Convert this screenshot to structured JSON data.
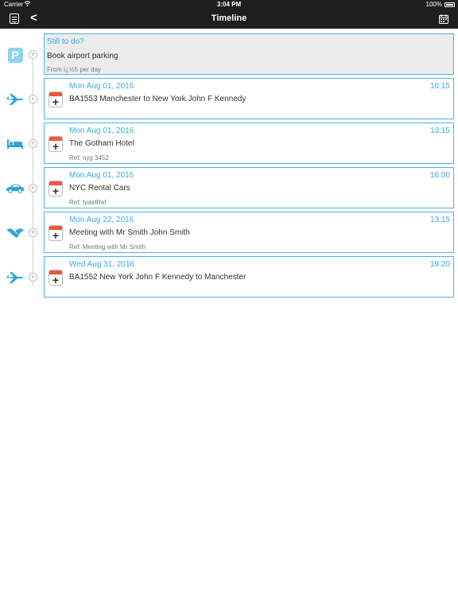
{
  "status_bar": {
    "carrier": "Carrier",
    "wifi_icon": "wifi-icon",
    "time": "3:04 PM",
    "battery": "100%"
  },
  "nav": {
    "title": "Timeline",
    "back_label": "<",
    "menu_icon": "menu-icon",
    "calendar_icon": "calendar-icon"
  },
  "colors": {
    "accent": "#3aa9dd",
    "border": "#4fb4e3",
    "bar": "#1e1e1e",
    "calendar_red": "#f0583d",
    "icon_blue": "#2ea4dc"
  },
  "todo": {
    "heading": "Still to do?",
    "title": "Book airport parking",
    "detail": "From ï¿½5 per day",
    "icon": "parking-icon"
  },
  "events": [
    {
      "date": "Mon Aug 01, 2016",
      "time": "10:15",
      "title": "BA1553 Manchester to New York John F Kennedy",
      "ref": "",
      "icon": "plane-icon"
    },
    {
      "date": "Mon Aug 01, 2016",
      "time": "13:15",
      "title": "The Gotham Hotel",
      "ref": "Ref: nyg 3452",
      "icon": "bed-icon"
    },
    {
      "date": "Mon Aug 01, 2016",
      "time": "16:00",
      "title": "NYC Rental Cars",
      "ref": "Ref: hotelRef",
      "icon": "car-icon"
    },
    {
      "date": "Mon Aug 22, 2016",
      "time": "13:15",
      "title": "Meeting with Mr Smith John Smith",
      "ref": "Ref: Meeting with Mr Smith",
      "icon": "handshake-icon"
    },
    {
      "date": "Wed Aug 31, 2016",
      "time": "19:20",
      "title": "BA1552 New York John F Kennedy to Manchester",
      "ref": "",
      "icon": "plane-icon"
    }
  ]
}
